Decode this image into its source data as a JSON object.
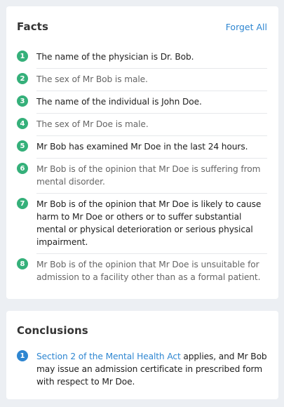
{
  "facts_card": {
    "title": "Facts",
    "forget_all_label": "Forget All",
    "items": [
      {
        "number": "1",
        "text": "The name of the physician is Dr. Bob."
      },
      {
        "number": "2",
        "text": "The sex of Mr Bob is male."
      },
      {
        "number": "3",
        "text": "The name of the individual is John Doe."
      },
      {
        "number": "4",
        "text": "The sex of Mr Doe is male."
      },
      {
        "number": "5",
        "text": "Mr Bob has examined Mr Doe in the last 24 hours."
      },
      {
        "number": "6",
        "text": "Mr Bob is of the opinion that Mr Doe is suffering from mental disorder."
      },
      {
        "number": "7",
        "text": "Mr Bob is of the opinion that Mr Doe is likely to cause harm to Mr Doe or others or to suffer substantial mental or physical deterioration or serious physical impairment."
      },
      {
        "number": "8",
        "text": "Mr Bob is of the opinion that Mr Doe is unsuitable for admission to a facility other than as a formal patient."
      }
    ]
  },
  "conclusions_card": {
    "title": "Conclusions",
    "items": [
      {
        "number": "1",
        "link_text": "Section 2 of the Mental Health Act",
        "text": " applies, and Mr Bob may issue an admission certificate in prescribed form with respect to Mr Doe."
      }
    ]
  },
  "colors": {
    "background": "#eceff3",
    "card": "#ffffff",
    "fact_badge": "#35b07a",
    "conclusion_badge": "#2e86d1",
    "link": "#2e86d1"
  }
}
